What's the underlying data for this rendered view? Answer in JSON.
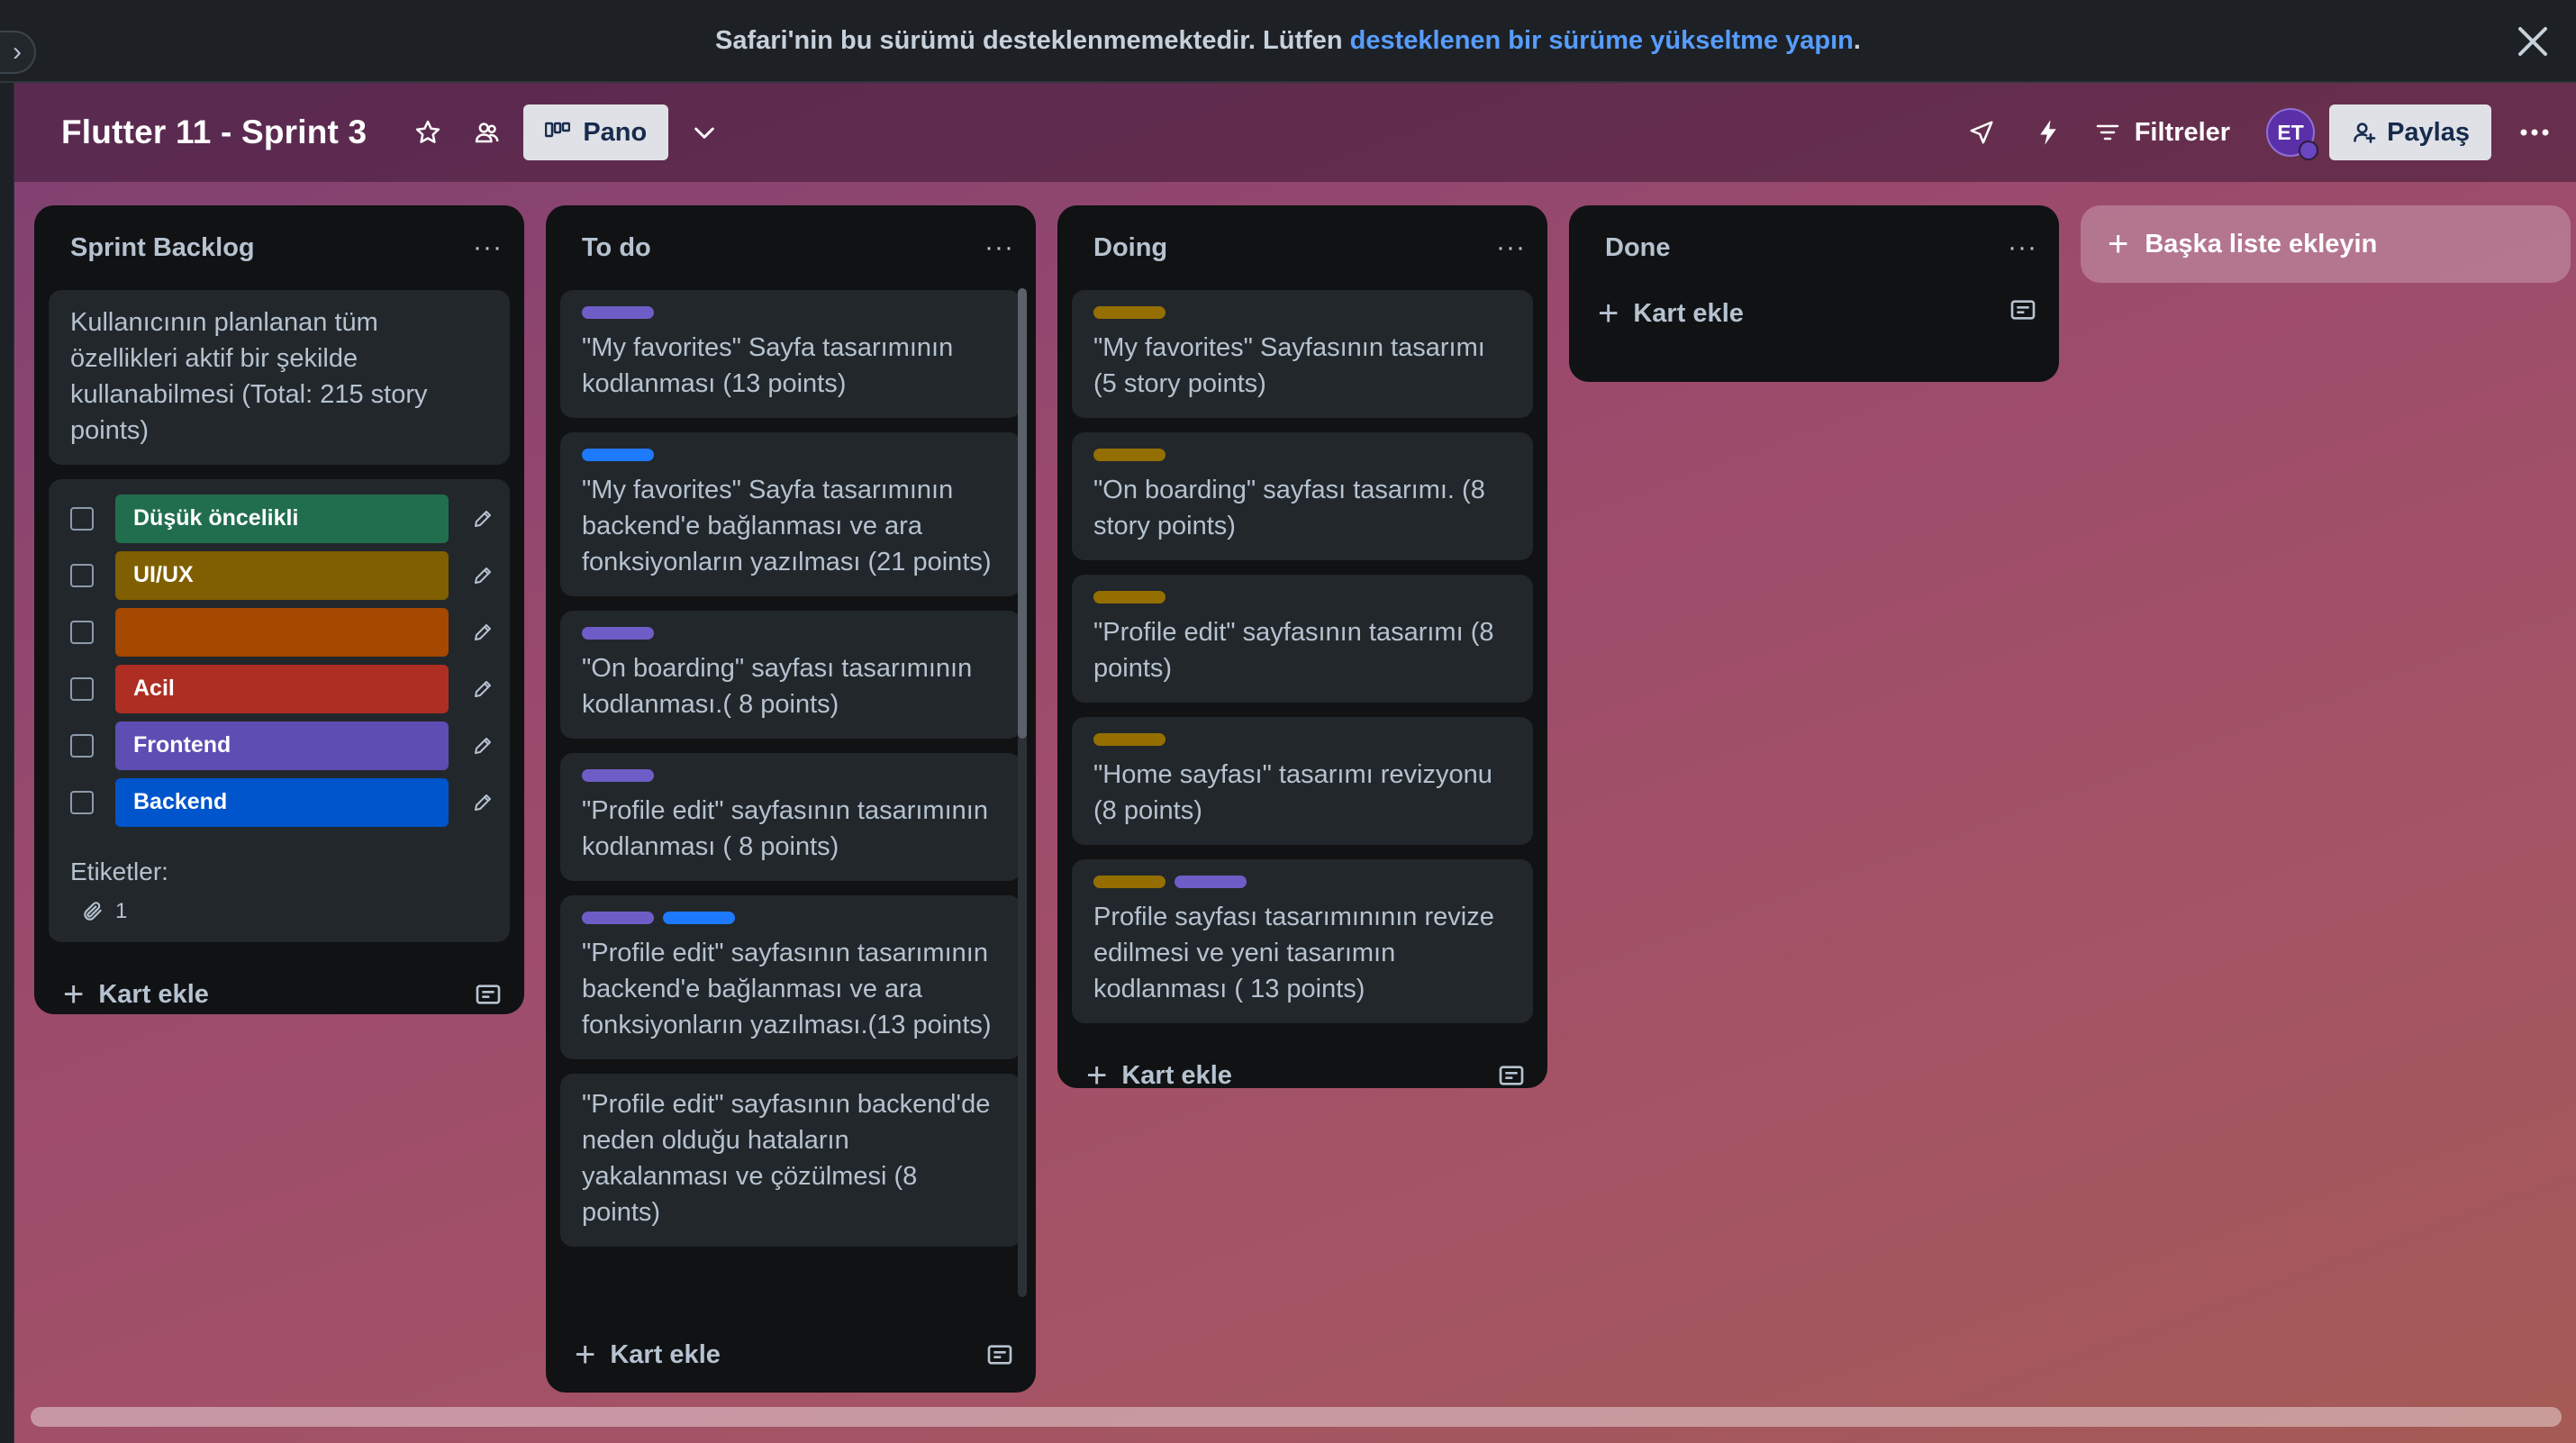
{
  "banner": {
    "text": "Safari'nin bu sürümü desteklenmemektedir. Lütfen",
    "link": "desteklenen bir sürüme yükseltme yapın",
    "end": "."
  },
  "header": {
    "board_title": "Flutter 11 - Sprint 3",
    "view_label": "Pano",
    "filters_label": "Filtreler",
    "avatar_initials": "ET",
    "share_label": "Paylaş"
  },
  "lists": [
    {
      "title": "Sprint Backlog",
      "cards": [
        {
          "text": "Kullanıcının planlanan tüm özellikleri aktif bir şekilde kullanabilmesi (Total: 215 story points)"
        }
      ],
      "label_editor": {
        "labels": [
          {
            "name": "Düşük öncelikli",
            "color": "#216e4e"
          },
          {
            "name": "UI/UX",
            "color": "#7f5f01"
          },
          {
            "name": "",
            "color": "#a54800"
          },
          {
            "name": "Acil",
            "color": "#ae2e24"
          },
          {
            "name": "Frontend",
            "color": "#5e4db2"
          },
          {
            "name": "Backend",
            "color": "#0055cc"
          }
        ],
        "section_title": "Etiketler:",
        "attachment_count": "1"
      },
      "add_card": "Kart ekle"
    },
    {
      "title": "To do",
      "cards": [
        {
          "labels": [
            "purple"
          ],
          "text": "\"My favorites\" Sayfa tasarımının kodlanması (13 points)"
        },
        {
          "labels": [
            "blue"
          ],
          "text": "\"My favorites\" Sayfa tasarımının backend'e bağlanması ve ara fonksiyonların yazılması (21 points)"
        },
        {
          "labels": [
            "purple"
          ],
          "text": "\"On boarding\" sayfası tasarımının kodlanması.( 8 points)"
        },
        {
          "labels": [
            "purple"
          ],
          "text": "\"Profile edit\" sayfasının tasarımının kodlanması ( 8 points)"
        },
        {
          "labels": [
            "purple",
            "blue"
          ],
          "text": "\"Profile edit\" sayfasının tasarımının backend'e bağlanması ve ara fonksiyonların yazılması.(13 points)"
        },
        {
          "labels": [],
          "text": "\"Profile edit\" sayfasının backend'de neden olduğu hataların yakalanması ve çözülmesi (8 points)"
        }
      ],
      "add_card": "Kart ekle"
    },
    {
      "title": "Doing",
      "cards": [
        {
          "labels": [
            "yellow"
          ],
          "text": "\"My favorites\" Sayfasının tasarımı (5 story points)"
        },
        {
          "labels": [
            "yellow"
          ],
          "text": "\"On boarding\" sayfası tasarımı. (8 story points)"
        },
        {
          "labels": [
            "yellow"
          ],
          "text": "\"Profile edit\" sayfasının tasarımı (8 points)"
        },
        {
          "labels": [
            "yellow"
          ],
          "text": "\"Home sayfası\" tasarımı revizyonu (8 points)"
        },
        {
          "labels": [
            "yellow",
            "purple"
          ],
          "text": "Profile sayfası tasarımınının revize edilmesi ve yeni tasarımın kodlanması ( 13 points)"
        }
      ],
      "add_card": "Kart ekle"
    },
    {
      "title": "Done",
      "cards": [],
      "add_card": "Kart ekle"
    }
  ],
  "add_list": "Başka liste ekleyin",
  "icons": {
    "star": "star-icon",
    "visibility": "workspace-visibility-icon",
    "board": "board-icon",
    "chevron": "chevron-down-icon",
    "powerups": "rocket-icon",
    "automation": "lightning-icon",
    "filter": "filter-icon",
    "share": "add-member-icon",
    "more": "more-icon",
    "template": "card-template-icon",
    "edit": "pencil-icon",
    "attachment": "paperclip-icon",
    "close": "close-icon"
  }
}
